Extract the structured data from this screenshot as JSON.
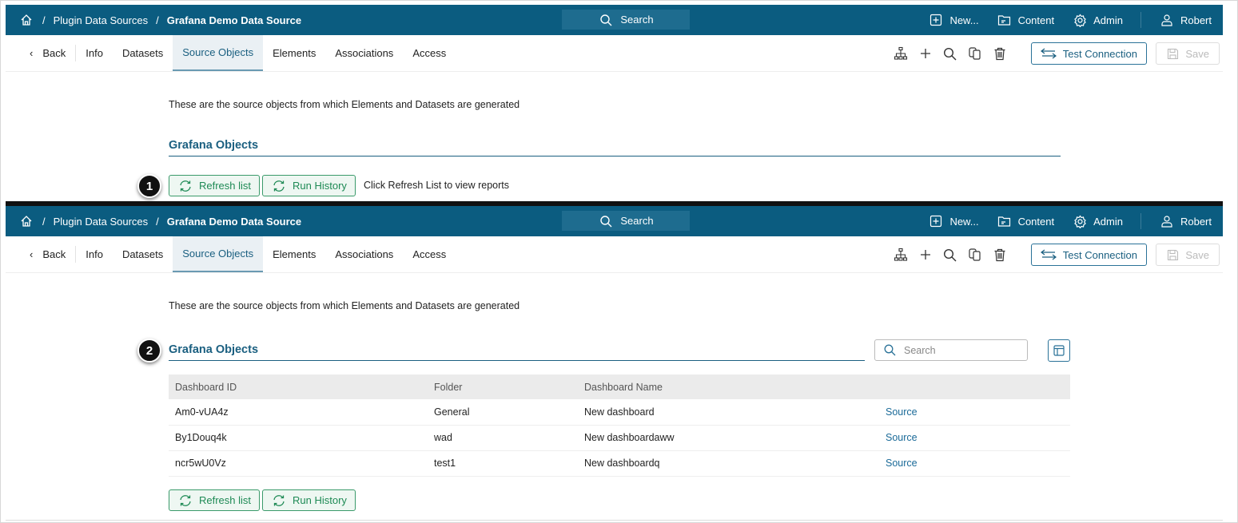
{
  "header": {
    "breadcrumb": [
      "Plugin Data Sources",
      "Grafana Demo Data Source"
    ],
    "search": "Search",
    "new": "New...",
    "content": "Content",
    "admin": "Admin",
    "user": "Robert"
  },
  "tabs": {
    "back": "Back",
    "items": [
      "Info",
      "Datasets",
      "Source Objects",
      "Elements",
      "Associations",
      "Access"
    ],
    "active": "Source Objects"
  },
  "toolbar": {
    "test_connection": "Test Connection",
    "save": "Save"
  },
  "intro": "These are the source objects from which Elements and Datasets are generated",
  "section_title": "Grafana Objects",
  "buttons": {
    "refresh": "Refresh list",
    "history": "Run History"
  },
  "hint": "Click Refresh List to view reports",
  "steps": [
    "1",
    "2"
  ],
  "table": {
    "search_placeholder": "Search",
    "headers": [
      "Dashboard ID",
      "Folder",
      "Dashboard Name",
      ""
    ],
    "rows": [
      [
        "Am0-vUA4z",
        "General",
        "New dashboard",
        "Source"
      ],
      [
        "By1Douq4k",
        "wad",
        "New dashboardaww",
        "Source"
      ],
      [
        "ncr5wU0Vz",
        "test1",
        "New dashboardq",
        "Source"
      ]
    ]
  },
  "colors": {
    "header": "#0b5c80",
    "accent": "#1a5f80",
    "green": "#1e8a55"
  }
}
